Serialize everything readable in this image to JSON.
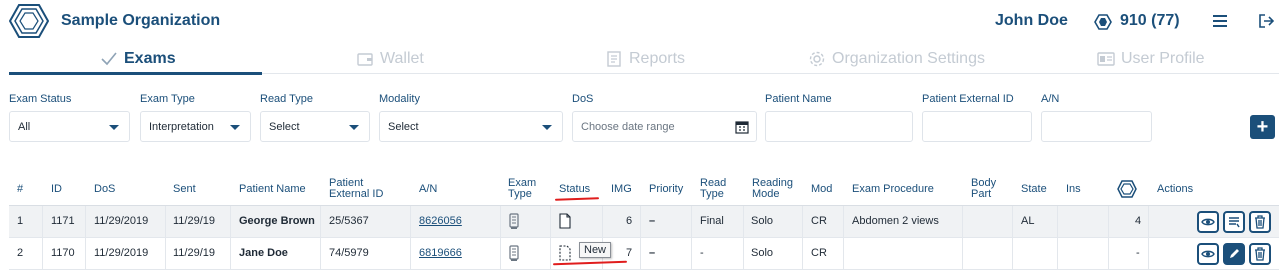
{
  "header": {
    "org_name": "Sample Organization",
    "user_name": "John Doe",
    "credits": "910 (77)",
    "logo_icon": "hexagon-logo-icon",
    "credits_icon": "credits-icon",
    "menu_icon": "hamburger-menu-icon",
    "logout_icon": "logout-icon"
  },
  "tabs": [
    {
      "label": "Exams",
      "icon": "check-icon",
      "active": true
    },
    {
      "label": "Wallet",
      "icon": "wallet-icon",
      "active": false
    },
    {
      "label": "Reports",
      "icon": "report-icon",
      "active": false
    },
    {
      "label": "Organization Settings",
      "icon": "gear-icon",
      "active": false
    },
    {
      "label": "User Profile",
      "icon": "id-card-icon",
      "active": false
    }
  ],
  "filters": {
    "exam_status": {
      "label": "Exam Status",
      "value": "All"
    },
    "exam_type": {
      "label": "Exam Type",
      "value": "Interpretation"
    },
    "read_type": {
      "label": "Read Type",
      "value": "Select"
    },
    "modality": {
      "label": "Modality",
      "value": "Select"
    },
    "dos": {
      "label": "DoS",
      "placeholder": "Choose date range"
    },
    "patient_name": {
      "label": "Patient Name",
      "value": ""
    },
    "patient_external_id": {
      "label": "Patient External ID",
      "value": ""
    },
    "an": {
      "label": "A/N",
      "value": ""
    },
    "add_label": "+"
  },
  "table": {
    "columns": [
      "#",
      "ID",
      "DoS",
      "Sent",
      "Patient Name",
      "Patient External ID",
      "A/N",
      "Exam Type",
      "Status",
      "IMG",
      "Priority",
      "Read Type",
      "Reading Mode",
      "Mod",
      "Exam Procedure",
      "Body Part",
      "State",
      "Ins",
      "",
      "Actions"
    ],
    "col_patient_ext_1": "Patient",
    "col_patient_ext_2": "External ID",
    "col_exam_type_1": "Exam",
    "col_exam_type_2": "Type",
    "col_read_type_1": "Read",
    "col_read_type_2": "Type",
    "col_reading_mode_1": "Reading",
    "col_reading_mode_2": "Mode",
    "col_body_part_1": "Body",
    "col_body_part_2": "Part",
    "rows": [
      {
        "num": "1",
        "id": "1171",
        "dos": "11/29/2019",
        "sent": "11/29/19",
        "patient_name": "George Brown",
        "ext_id": "25/5367",
        "an": "8626056",
        "img": "6",
        "priority": "–",
        "read_type": "Final",
        "reading_mode": "Solo",
        "mod": "CR",
        "procedure": "Abdomen 2 views",
        "body_part": "",
        "state": "AL",
        "ins": "",
        "credits": "4",
        "status_icon": "document-icon"
      },
      {
        "num": "2",
        "id": "1170",
        "dos": "11/29/2019",
        "sent": "11/29/19",
        "patient_name": "Jane Doe",
        "ext_id": "74/5979",
        "an": "6819666",
        "img": "7",
        "priority": "–",
        "read_type": "-",
        "reading_mode": "Solo",
        "mod": "CR",
        "procedure": "",
        "body_part": "",
        "state": "",
        "ins": "",
        "credits": "-",
        "status_icon": "new-document-icon"
      }
    ],
    "tooltip": "New"
  },
  "colors": {
    "primary": "#1b4f7a",
    "muted": "#c4cbd3",
    "annotation": "#e01d1d",
    "row_highlight": "#f0f2f4"
  }
}
